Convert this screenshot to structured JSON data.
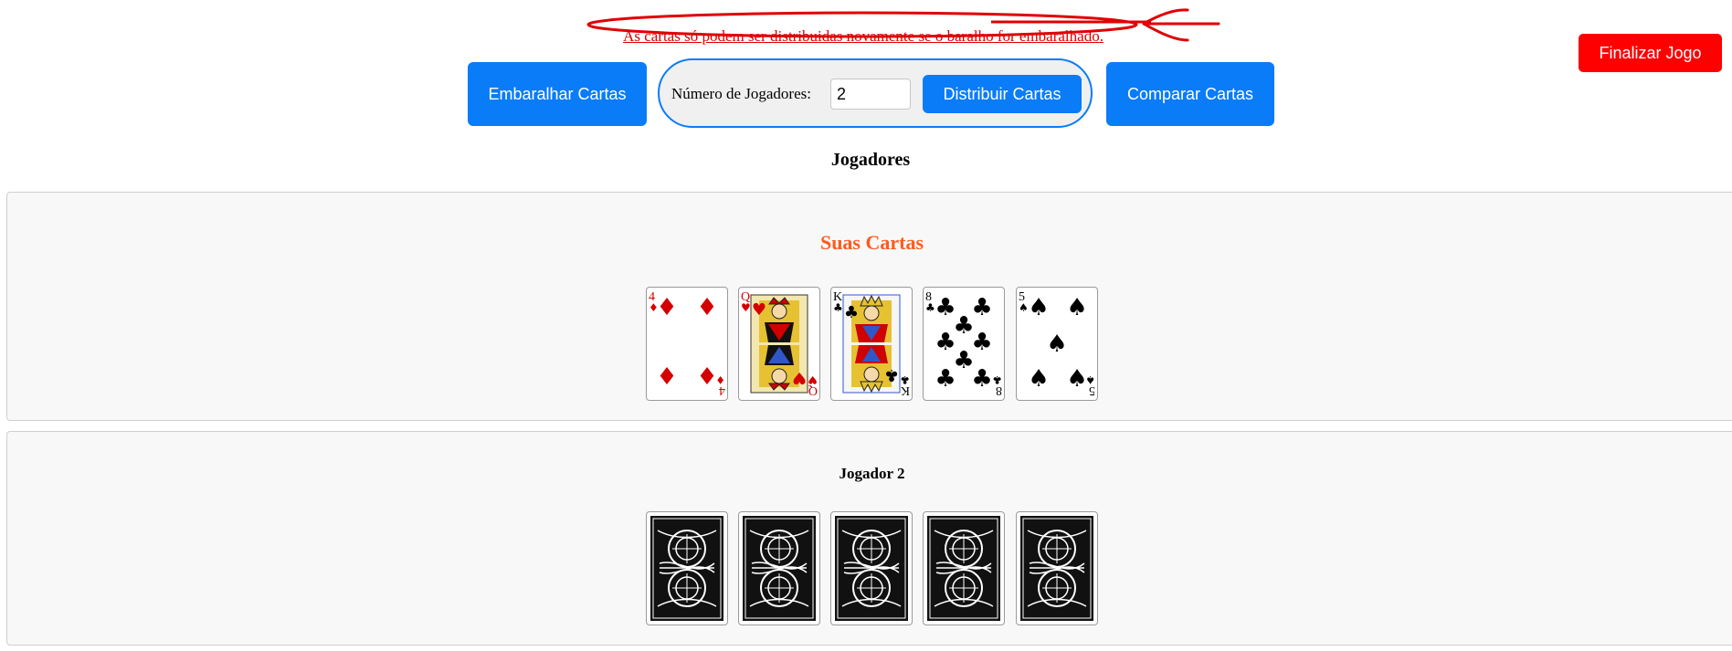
{
  "warning": {
    "text": "As cartas só podem ser distribuidas novamente se o baralho for embaralhado.",
    "annotation_color": "#e00000"
  },
  "toolbar": {
    "shuffle_label": "Embaralhar Cartas",
    "players_label": "Número de Jogadores:",
    "players_value": "2",
    "deal_label": "Distribuir Cartas",
    "compare_label": "Comparar Cartas",
    "finish_label": "Finalizar Jogo"
  },
  "colors": {
    "primary": "#0a7cf7",
    "danger": "#ff0000",
    "highlight": "#ff5a1f"
  },
  "players_title": "Jogadores",
  "your_hand": {
    "title": "Suas Cartas",
    "cards": [
      {
        "rank": "4",
        "suit": "♦",
        "color": "red"
      },
      {
        "rank": "Q",
        "suit": "♥",
        "color": "red"
      },
      {
        "rank": "K",
        "suit": "♣",
        "color": "black"
      },
      {
        "rank": "8",
        "suit": "♣",
        "color": "black"
      },
      {
        "rank": "5",
        "suit": "♠",
        "color": "black"
      }
    ]
  },
  "player2": {
    "title": "Jogador 2",
    "card_back": "card-back-pattern"
  }
}
